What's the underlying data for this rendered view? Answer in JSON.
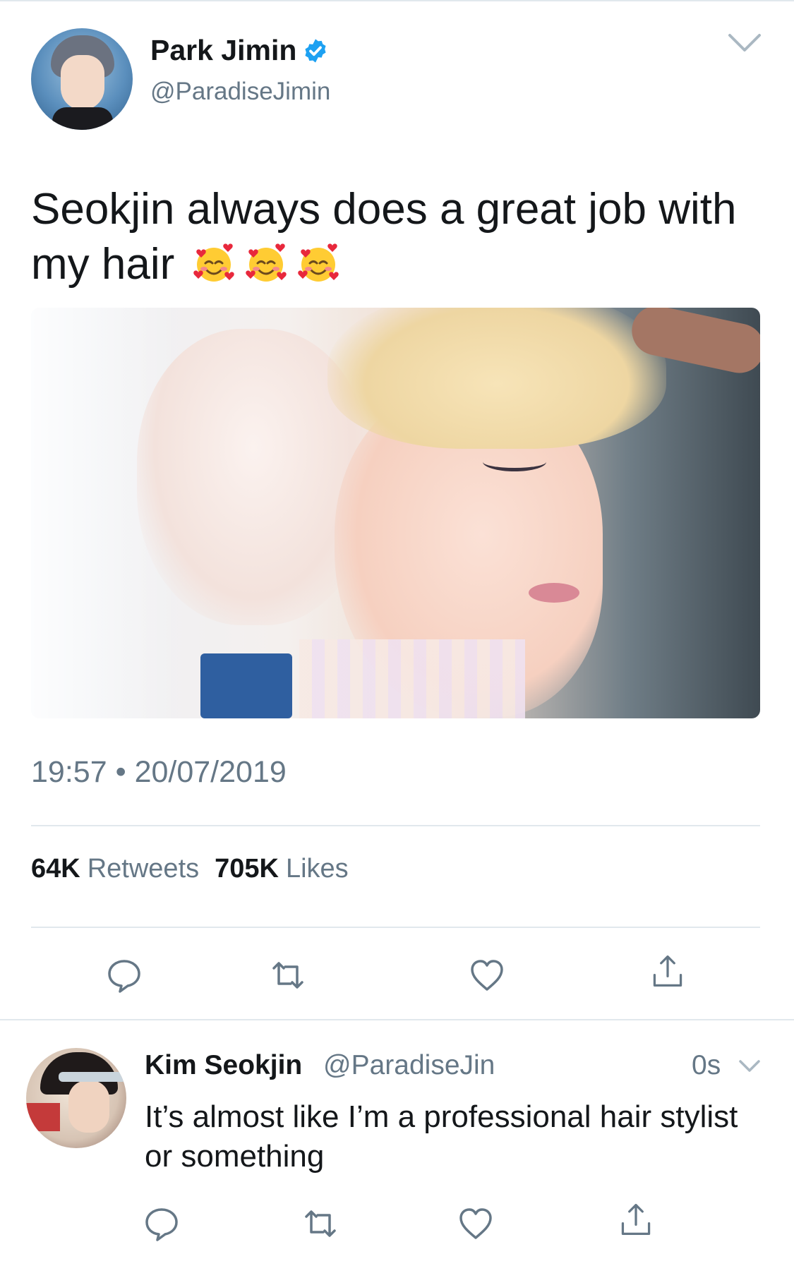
{
  "tweet": {
    "author_name": "Park Jimin",
    "author_handle": "@ParadiseJimin",
    "verified": true,
    "text": "Seokjin always does a great job with my hair",
    "emoji": [
      "smiling-face-with-hearts",
      "smiling-face-with-hearts",
      "smiling-face-with-hearts"
    ],
    "time": "19:57",
    "separator": "•",
    "date": "20/07/2019",
    "stats": {
      "retweets_count": "64K",
      "retweets_label": "Retweets",
      "likes_count": "705K",
      "likes_label": "Likes"
    },
    "actions": [
      "reply-icon",
      "retweet-icon",
      "like-icon",
      "share-icon"
    ]
  },
  "reply": {
    "author_name": "Kim Seokjin",
    "author_handle": "@ParadiseJin",
    "time": "0s",
    "text": "It’s almost like I’m a professional hair stylist or something",
    "actions": [
      "reply-icon",
      "retweet-icon",
      "like-icon",
      "share-icon"
    ]
  },
  "colors": {
    "text_primary": "#14171a",
    "text_secondary": "#657786",
    "verified_blue": "#1da1f2",
    "divider": "#e1e8ed"
  }
}
